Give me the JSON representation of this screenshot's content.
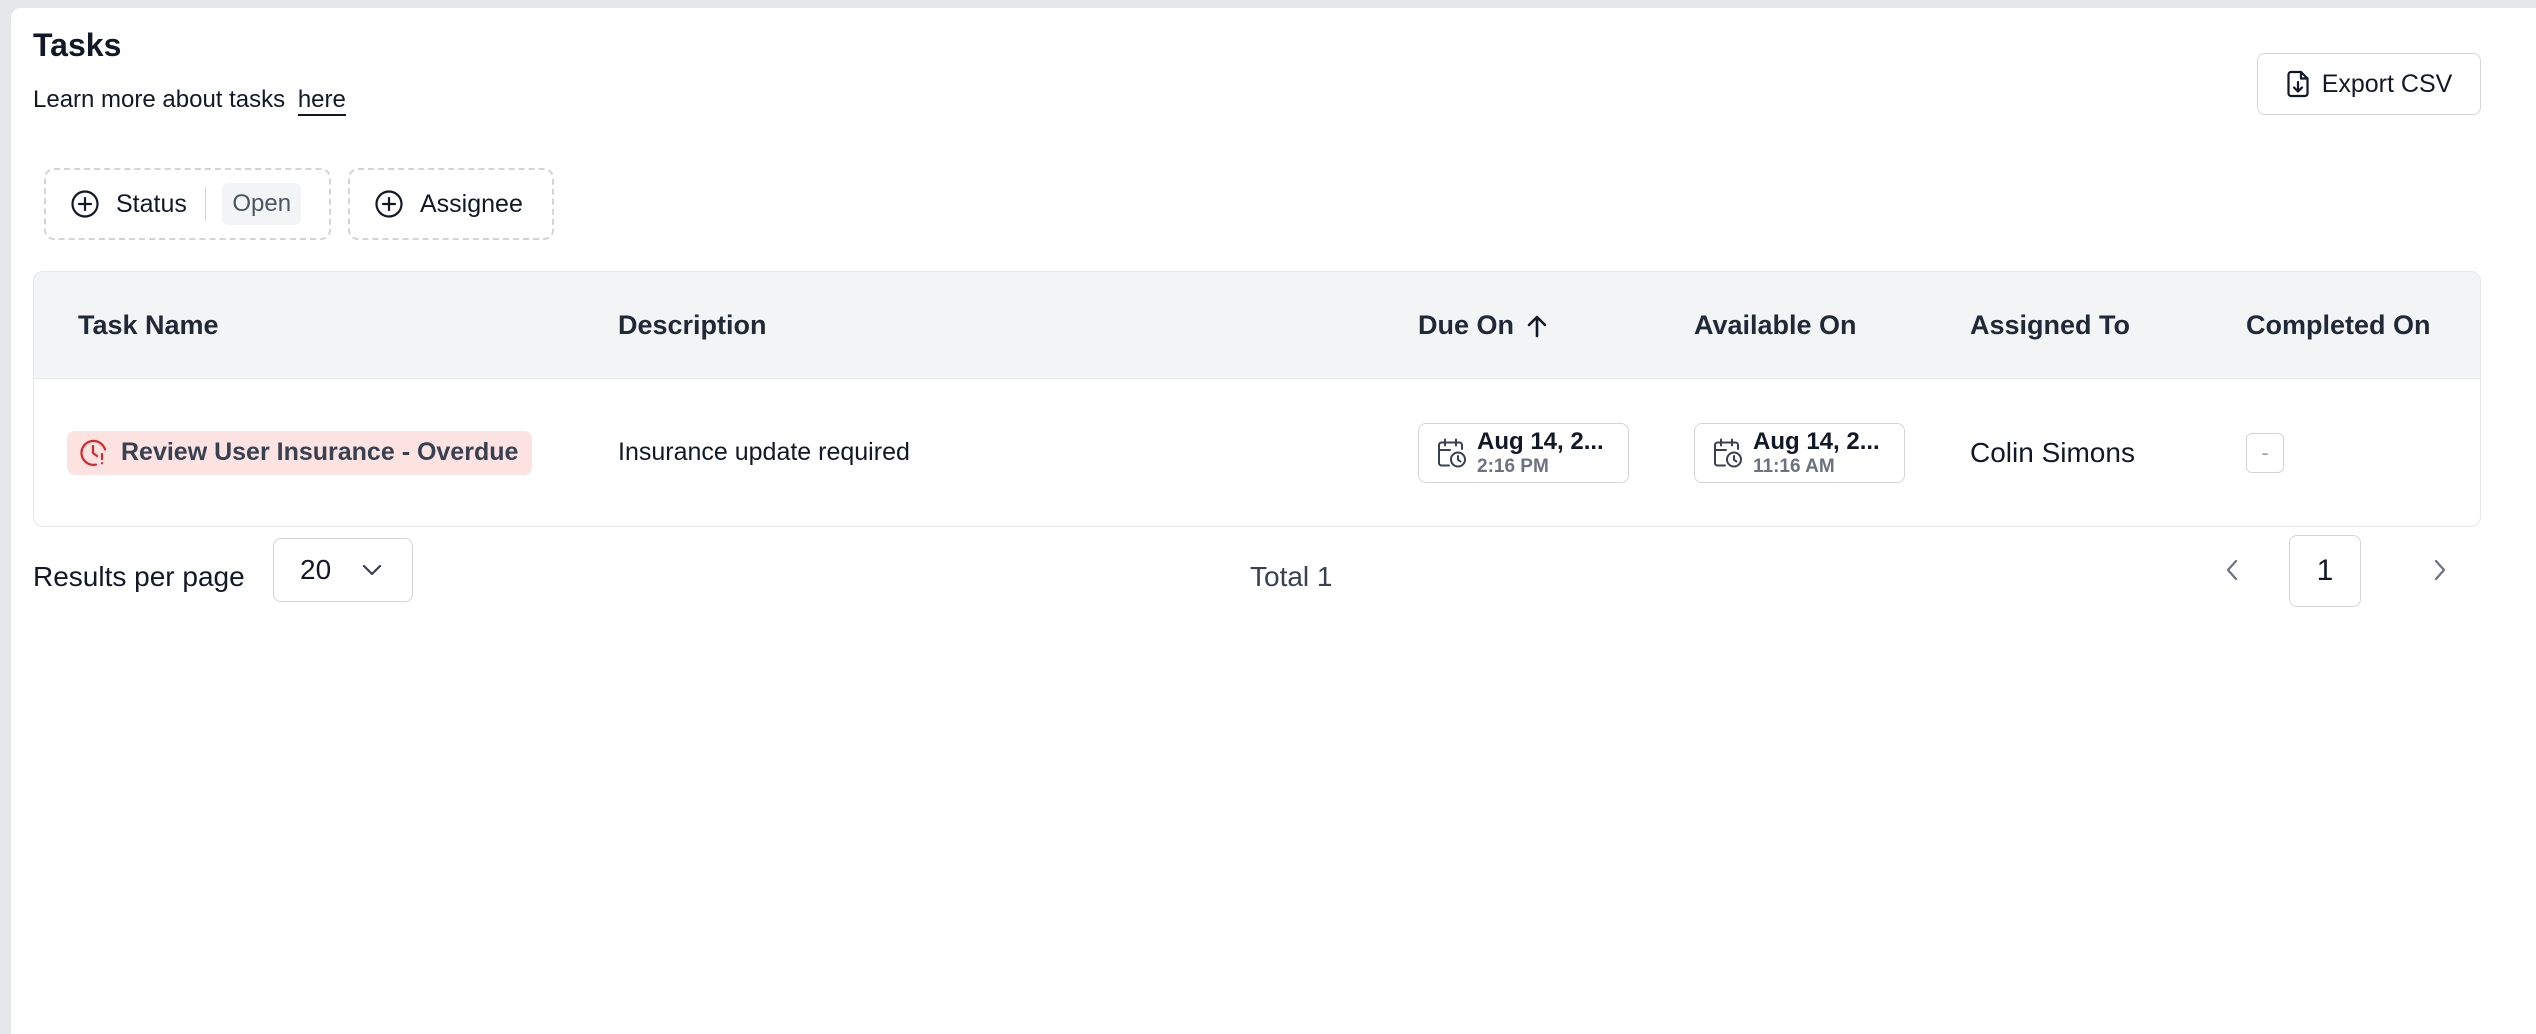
{
  "header": {
    "title": "Tasks",
    "subtitle_text": "Learn more about tasks",
    "subtitle_link": "here",
    "export_label": "Export CSV"
  },
  "filters": [
    {
      "label": "Status",
      "value": "Open",
      "icon": "plus-circle-icon"
    },
    {
      "label": "Assignee",
      "icon": "plus-circle-icon"
    }
  ],
  "table": {
    "columns": [
      "Task Name",
      "Description",
      "Due On",
      "Available On",
      "Assigned To",
      "Completed On"
    ],
    "sorted_column": "Due On",
    "sort_direction": "ascending",
    "rows": [
      {
        "task_name": "Review User Insurance - Overdue",
        "task_status_icon": "clock-alert-icon",
        "description": "Insurance update required",
        "due_on_date": "Aug 14, 2...",
        "due_on_time": "2:16 PM",
        "available_on_date": "Aug 14, 2...",
        "available_on_time": "11:16 AM",
        "assigned_to": "Colin Simons",
        "completed_on": "-"
      }
    ]
  },
  "pagination": {
    "results_per_page_label": "Results per page",
    "results_per_page": "20",
    "total_label": "Total 1",
    "current_page": "1"
  },
  "colors": {
    "overdue_bg": "#fde2e2",
    "overdue_icon": "#dc2626",
    "header_bg": "#f3f4f6",
    "border": "#d1d5db"
  }
}
